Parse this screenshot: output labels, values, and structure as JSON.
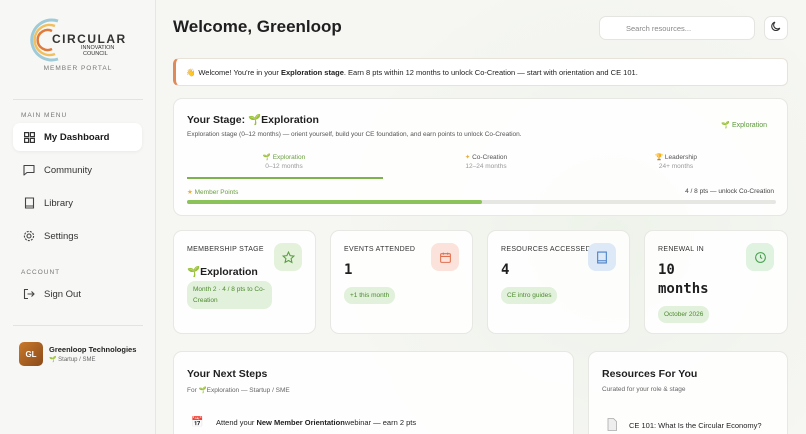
{
  "sidebar": {
    "logo": {
      "word": "CIRCULAR",
      "line2": "INNOVATION",
      "line3": "COUNCIL"
    },
    "portal_label": "MEMBER PORTAL",
    "main_menu_label": "MAIN MENU",
    "items": [
      {
        "label": "My Dashboard",
        "icon": "grid-icon"
      },
      {
        "label": "Community",
        "icon": "chat-icon"
      },
      {
        "label": "Library",
        "icon": "book-icon"
      },
      {
        "label": "Settings",
        "icon": "gear-icon"
      }
    ],
    "account_label": "ACCOUNT",
    "signout_label": "Sign Out",
    "user": {
      "initials": "GL",
      "name": "Greenloop Technologies",
      "type": "Startup / SME"
    }
  },
  "header": {
    "title": "Welcome, Greenloop",
    "search_placeholder": "Search resources..."
  },
  "banner": {
    "emoji": "👋",
    "pre": "Welcome! You're in your ",
    "bold": "Exploration stage",
    "post": ". Earn 8 pts within 12 months to unlock Co-Creation — start with orientation and CE 101."
  },
  "stage": {
    "title_prefix": "Your Stage:",
    "title_stage": "Exploration",
    "desc": "Exploration stage (0–12 months) — orient yourself, build your CE foundation, and earn points to unlock Co-Creation.",
    "badge": "Exploration",
    "steps": [
      {
        "name": "Exploration",
        "range": "0–12 months"
      },
      {
        "name": "Co-Creation",
        "range": "12–24 months"
      },
      {
        "name": "Leadership",
        "range": "24+ months"
      }
    ],
    "points_label": "Member Points",
    "points_text": "4 / 8 pts — unlock Co-Creation",
    "points_progress": 0.5
  },
  "stats": [
    {
      "label": "MEMBERSHIP STAGE",
      "value": "Exploration",
      "pill": "Month 2 · 4 / 8 pts to Co-Creation",
      "icon": "star-icon",
      "icon_bg": "#e4f2dc",
      "icon_color": "#5aa040"
    },
    {
      "label": "EVENTS ATTENDED",
      "value": "1",
      "pill": "+1 this month",
      "icon": "calendar-icon",
      "icon_bg": "#fbe3dc",
      "icon_color": "#e07050"
    },
    {
      "label": "RESOURCES ACCESSED",
      "value": "4",
      "pill": "CE intro guides",
      "icon": "book-icon",
      "icon_bg": "#dde9f7",
      "icon_color": "#4a80c8"
    },
    {
      "label": "RENEWAL IN",
      "value": "10 months",
      "pill": "October 2026",
      "icon": "clock-icon",
      "icon_bg": "#e0f2e0",
      "icon_color": "#4aa050"
    }
  ],
  "next_steps": {
    "title": "Your Next Steps",
    "sub_prefix": "For",
    "sub_stage": "Exploration",
    "sub_rest": "— Startup / SME",
    "item": {
      "pre": "Attend your ",
      "bold": "New Member Orientation",
      "post": " webinar — earn 2 pts"
    }
  },
  "resources": {
    "title": "Resources For You",
    "sub": "Curated for your role & stage",
    "item": "CE 101: What Is the Circular Economy?"
  }
}
